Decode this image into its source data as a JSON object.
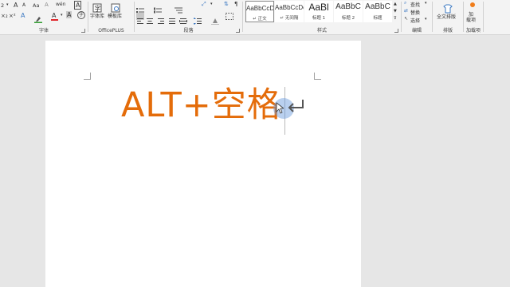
{
  "ribbon": {
    "font_group": {
      "label": "字体",
      "font_size": "2",
      "font_size_arrow": "▾",
      "grow_font": "A",
      "shrink_font": "A",
      "clear_format": "A",
      "font_color": "A",
      "char_border": "A"
    },
    "officeplus_group": {
      "label": "OfficePLUS",
      "font_lib_label": "字体库",
      "template_lib_label": "模板库"
    },
    "paragraph_group": {
      "label": "段落"
    },
    "styles_group": {
      "label": "样式",
      "items": [
        {
          "sample": "AaBbCcDc",
          "name": "↵ 正文"
        },
        {
          "sample": "AaBbCcDc",
          "name": "↵ 无间隔"
        },
        {
          "sample": "AaBl",
          "name": "标题 1"
        },
        {
          "sample": "AaBbC",
          "name": "标题 2"
        },
        {
          "sample": "AaBbC",
          "name": "标题"
        }
      ]
    },
    "editing_group": {
      "label": "编辑",
      "find": "查找",
      "replace": "替换",
      "select": "选择"
    },
    "layout_group": {
      "label": "排版",
      "full_layout": "全文排版"
    },
    "addins_group": {
      "label": "加载项",
      "addin": "加\n载项"
    }
  },
  "document": {
    "heading_text": "ALT+空格"
  },
  "colors": {
    "heading": "#e46c0a",
    "font_color_bar": "#e0262b",
    "highlight_bar": "#2e9c2e",
    "addin_dot": "#f07d1a"
  }
}
